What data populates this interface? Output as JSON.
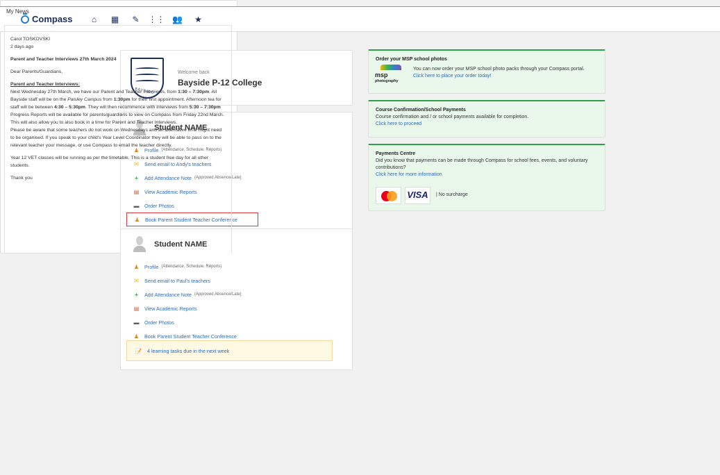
{
  "topbar": {
    "logo_text": "Compass",
    "icons": [
      "home-icon",
      "calendar-icon",
      "pencil-icon",
      "grid-icon",
      "people-icon",
      "star-icon"
    ]
  },
  "school": {
    "welcome": "Welcome back",
    "name": "Bayside P-12 College",
    "crest_text": "BAYSIDE"
  },
  "students": [
    {
      "name": "Student NAME",
      "links": [
        {
          "label": "Profile",
          "sub": "(Attendance, Schedule, Reports)",
          "icon": "profile-icon"
        },
        {
          "label": "Send email to Andy's teachers",
          "icon": "mail-icon"
        },
        {
          "label": "Add Attendance Note",
          "sub": "(Approved Absence/Late)",
          "icon": "plus-icon"
        },
        {
          "label": "View Academic Reports",
          "icon": "report-icon"
        },
        {
          "label": "Order Photos",
          "icon": "photo-icon"
        },
        {
          "label": "Book Parent Student Teacher Conference",
          "icon": "conference-icon"
        }
      ]
    },
    {
      "name": "Student NAME",
      "links": [
        {
          "label": "Profile",
          "sub": "(Attendance, Schedule, Reports)",
          "icon": "profile-icon"
        },
        {
          "label": "Send email to Paul's teachers",
          "icon": "mail-icon"
        },
        {
          "label": "Add Attendance Note",
          "sub": "(Approved Absence/Late)",
          "icon": "plus-icon"
        },
        {
          "label": "View Academic Reports",
          "icon": "report-icon"
        },
        {
          "label": "Order Photos",
          "icon": "photo-icon"
        },
        {
          "label": "Book Parent Student Teacher Conference",
          "icon": "conference-icon"
        }
      ],
      "tasks": "4 learning tasks due in the next week"
    }
  ],
  "notices": {
    "msp": {
      "title": "Order your MSP school photos",
      "line1": "You can now order your MSP school photo packs through your Compass portal.",
      "link": "Click here to place your order today!",
      "logo_text": "msp",
      "logo_sub": "photography"
    },
    "course": {
      "title": "Course Confirmation/School Payments",
      "text": "Course confirmation and / or school payments available for completion.",
      "link": "Click here to proceed"
    },
    "payments": {
      "title": "Payments Centre",
      "text": "Did you know that payments can be made through Compass for school fees, events, and voluntary contributions?",
      "link": "Click here for more information",
      "visa_text": "VISA",
      "surcharge": "| No surcharge"
    }
  },
  "news": {
    "title": "My News",
    "author": "Carol TOSKOVSKI",
    "time": "2 days ago",
    "headline": "Parent and Teacher Interviews 27th March 2024",
    "greeting": "Dear Parents/Guardians,",
    "subheading": "Parent and Teacher Interviews:",
    "paragraph1_a": "Next Wednesday 27th March, we have our Parent and Teacher Interviews, from ",
    "paragraph1_b": "1:30 – 7:30pm",
    "paragraph1_c": ". All Bayside staff will be on the ",
    "paragraph1_d": "Paisley Campus",
    "paragraph1_e": " from ",
    "paragraph1_f": "1:30pm",
    "paragraph1_g": " for their first appointment.  Afternoon tea for staff will be between ",
    "paragraph1_h": "4:30 – 5:30pm",
    "paragraph1_i": ".  They will then recommence with interviews from ",
    "paragraph1_j": "5:30 – 7:30pm",
    "paragraph2": "Progress Reports will be available for parents/guardians to view on Compass from Friday 22nd March.  This will also allow you to also book in a time for Parent and Teacher Interviews.",
    "paragraph3": "Please be aware that some teachers do not work on Wednesdays and an alternative time might need to be organised.  If you speak to your child's Year Level Coordinator they will be able to pass on to the relevant teacher your message, or use Compass to email the teacher directly.",
    "paragraph4": "Year 12 VET classes will be running as per the timetable. This is a student free day for all other students.",
    "closing": "Thank you"
  }
}
